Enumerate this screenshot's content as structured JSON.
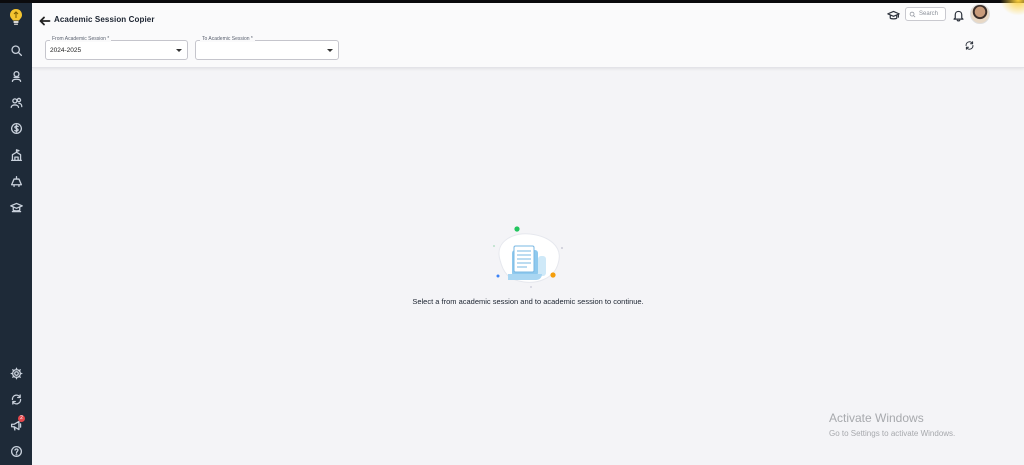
{
  "page": {
    "title": "Academic Session Copier"
  },
  "sidebar": {
    "items": [
      {
        "icon": "search-icon"
      },
      {
        "icon": "student-icon"
      },
      {
        "icon": "users-icon"
      },
      {
        "icon": "dollar-icon"
      },
      {
        "icon": "building-icon"
      },
      {
        "icon": "transport-icon"
      },
      {
        "icon": "graduation-icon"
      },
      {
        "icon": "settings-icon"
      },
      {
        "icon": "sync-icon"
      },
      {
        "icon": "megaphone-icon"
      },
      {
        "icon": "help-icon"
      }
    ],
    "notification_count": "2"
  },
  "form": {
    "from_label": "From Academic Session *",
    "from_value": "2024-2025",
    "to_label": "To Academic Session *",
    "to_value": ""
  },
  "header": {
    "search_placeholder": "Search"
  },
  "empty_state": {
    "message": "Select a from academic session and to academic session to continue."
  },
  "watermark": {
    "line1": "Activate Windows",
    "line2": "Go to Settings to activate Windows."
  },
  "colors": {
    "sidebar": "#1e2a38",
    "background": "#f4f4f7",
    "accent_green": "#22c55e",
    "accent_orange": "#f59e0b",
    "accent_blue": "#3b82f6"
  }
}
